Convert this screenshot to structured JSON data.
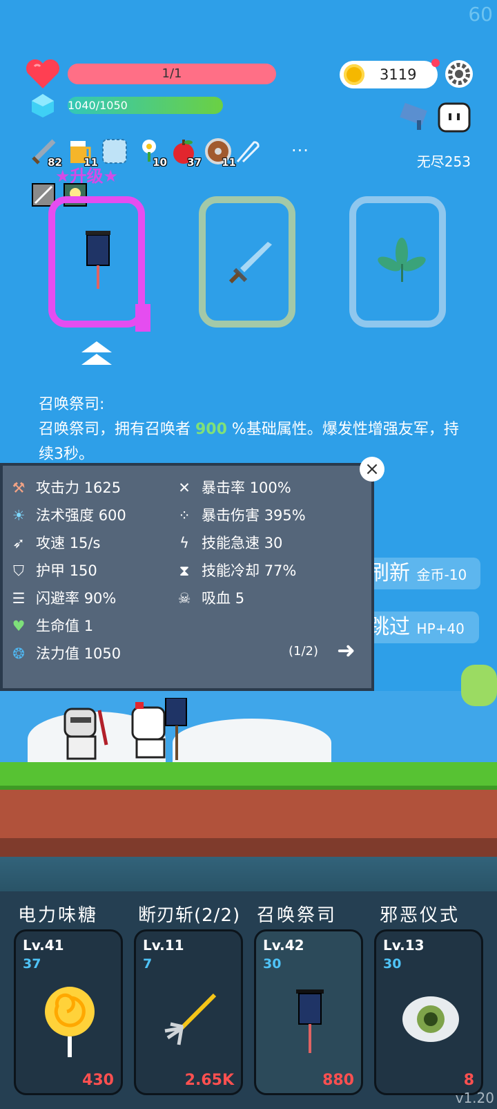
{
  "fps": "60",
  "hud": {
    "hp": "1/1",
    "mp": "1040/1050",
    "coins": "3119",
    "mode": "无尽253",
    "more": "···"
  },
  "inventory": [
    {
      "icon": "sword-icon",
      "count": "82"
    },
    {
      "icon": "beer-icon",
      "count": "11"
    },
    {
      "icon": "empty-slot-icon",
      "count": ""
    },
    {
      "icon": "flower-icon",
      "count": "10"
    },
    {
      "icon": "apple-icon",
      "count": "37"
    },
    {
      "icon": "shield-icon",
      "count": "11"
    },
    {
      "icon": "pin-icon",
      "count": ""
    }
  ],
  "upgrade_label": "★升级★",
  "selected": {
    "title": "召唤祭司:",
    "desc_before": "召唤祭司，拥有召唤者 ",
    "desc_value": "900",
    "desc_after": " %基础属性。爆发性增强友军，持续3秒。"
  },
  "stats": {
    "left": [
      {
        "icon": "axe-icon",
        "label": "攻击力",
        "value": "1625"
      },
      {
        "icon": "sun-icon",
        "label": "法术强度",
        "value": "600"
      },
      {
        "icon": "bow-icon",
        "label": "攻速",
        "value": "15/s"
      },
      {
        "icon": "armor-icon",
        "label": "护甲",
        "value": "150"
      },
      {
        "icon": "dodge-icon",
        "label": "闪避率",
        "value": "90%"
      },
      {
        "icon": "heart-icon",
        "label": "生命值",
        "value": "1"
      },
      {
        "icon": "crystal-icon",
        "label": "法力值",
        "value": "1050"
      }
    ],
    "right": [
      {
        "icon": "crit-icon",
        "label": "暴击率",
        "value": "100%"
      },
      {
        "icon": "crit-dmg-icon",
        "label": "暴击伤害",
        "value": "395%"
      },
      {
        "icon": "lightning-icon",
        "label": "技能急速",
        "value": "30"
      },
      {
        "icon": "hourglass-icon",
        "label": "技能冷却",
        "value": "77%"
      },
      {
        "icon": "skull-icon",
        "label": "吸血",
        "value": "5"
      }
    ],
    "page": "(1/2)"
  },
  "actions": {
    "refresh": "刷新",
    "refresh_cost": "金币-10",
    "skip": "跳过",
    "skip_gain": "HP+40"
  },
  "skills": [
    {
      "name": "电力味糖",
      "lv": "Lv.41",
      "sub": "37",
      "cost": "430",
      "icon": "lollipop-icon"
    },
    {
      "name": "断刃斩(2/2)",
      "lv": "Lv.11",
      "sub": "7",
      "cost": "2.65K",
      "icon": "pitchfork-icon"
    },
    {
      "name": "召唤祭司",
      "lv": "Lv.42",
      "sub": "30",
      "cost": "880",
      "icon": "banner-icon"
    },
    {
      "name": "邪恶仪式",
      "lv": "Lv.13",
      "sub": "30",
      "cost": "8",
      "icon": "eye-icon"
    }
  ],
  "version": "v1.20"
}
